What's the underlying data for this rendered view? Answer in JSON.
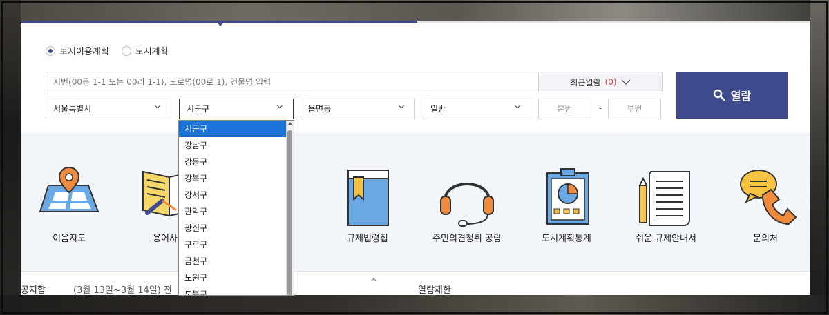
{
  "radios": [
    {
      "label": "토지이용계획",
      "checked": true
    },
    {
      "label": "도시계획",
      "checked": false
    }
  ],
  "search": {
    "placeholder": "지번(00동 1-1 또는 00리 1-1), 도로명(00로 1), 건물명 입력",
    "recent_label": "최근열람",
    "recent_count": "(0)",
    "view_label": "열람"
  },
  "selects": {
    "sido": "서울특별시",
    "sigungu": "시군구",
    "eupmyeondong": "읍면동",
    "type": "일반",
    "bonbeon": "본번",
    "dash": "-",
    "bubeon": "부번"
  },
  "dropdown": {
    "items": [
      "시군구",
      "강남구",
      "강동구",
      "강북구",
      "강서구",
      "관악구",
      "광진구",
      "구로구",
      "금천구",
      "노원구",
      "도봉구"
    ],
    "selected": "시군구"
  },
  "quick_links": [
    {
      "label": "이음지도",
      "icon": "map-pin-icon"
    },
    {
      "label": "용어사전",
      "icon": "dictionary-icon"
    },
    {
      "label": "규제법령집",
      "icon": "law-book-icon"
    },
    {
      "label": "주민의견청취 공람",
      "icon": "headset-icon"
    },
    {
      "label": "도시계획통계",
      "icon": "statistics-board-icon"
    },
    {
      "label": "쉬운 규제안내서",
      "icon": "guide-document-icon"
    },
    {
      "label": "문의처",
      "icon": "phone-chat-icon"
    }
  ],
  "notice": {
    "title": "공지함",
    "text": "(3월 13일~3월 14일) 전",
    "right_text": "열람제한"
  },
  "colors": {
    "primary": "#3e4a8c",
    "selected": "#1a73d9",
    "count_red": "#d23b3b"
  }
}
